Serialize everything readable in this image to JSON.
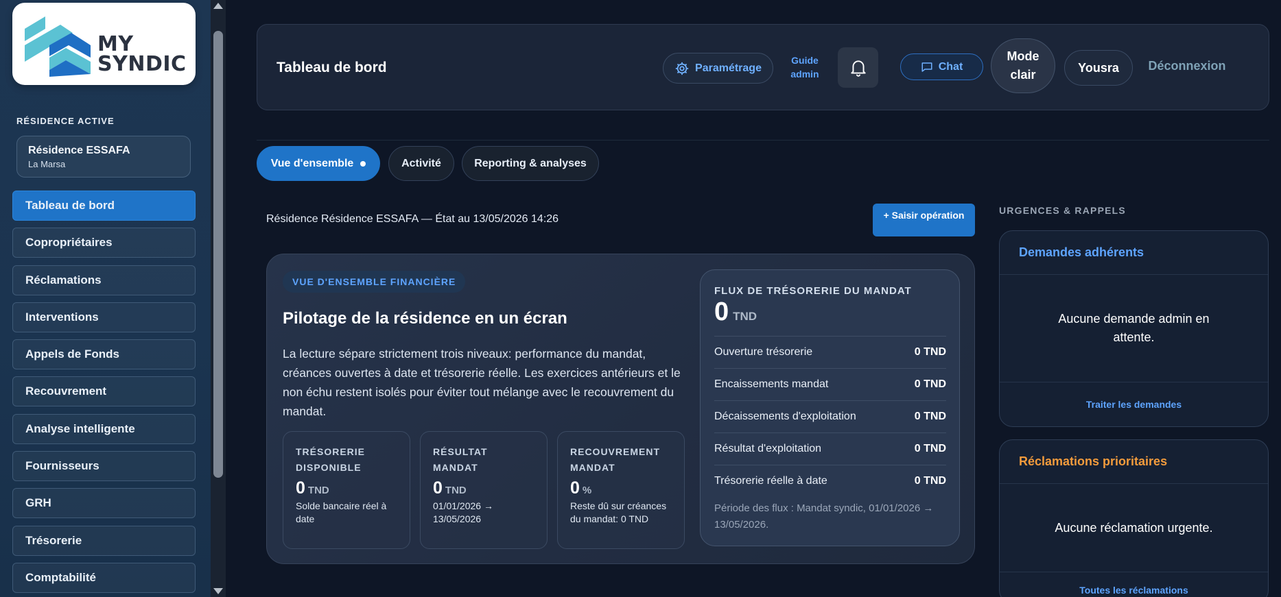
{
  "logo": {
    "line1": "MY",
    "line2": "SYNDIC"
  },
  "sidebar": {
    "active_residence_label": "RÉSIDENCE ACTIVE",
    "residence": {
      "name": "Résidence ESSAFA",
      "city": "La Marsa"
    },
    "items": [
      {
        "label": "Tableau de bord",
        "active": true
      },
      {
        "label": "Copropriétaires"
      },
      {
        "label": "Réclamations"
      },
      {
        "label": "Interventions"
      },
      {
        "label": "Appels de Fonds"
      },
      {
        "label": "Recouvrement"
      },
      {
        "label": "Analyse intelligente"
      },
      {
        "label": "Fournisseurs"
      },
      {
        "label": "GRH"
      },
      {
        "label": "Trésorerie"
      },
      {
        "label": "Comptabilité"
      }
    ]
  },
  "header": {
    "title": "Tableau de bord",
    "parametrage": "Paramétrage",
    "guide_line1": "Guide",
    "guide_line2": "admin",
    "chat": "Chat",
    "mode_line1": "Mode",
    "mode_line2": "clair",
    "user": "Yousra",
    "logout": "Déconnexion"
  },
  "tabs": [
    {
      "label": "Vue d'ensemble",
      "active": true
    },
    {
      "label": "Activité"
    },
    {
      "label": "Reporting & analyses"
    }
  ],
  "main": {
    "status_line": "Résidence Résidence ESSAFA — État au 13/05/2026 14:26",
    "saisir_button": "+ Saisir opération",
    "financial": {
      "badge": "VUE D'ENSEMBLE FINANCIÈRE",
      "title": "Pilotage de la résidence en un écran",
      "description": "La lecture sépare strictement trois niveaux: performance du mandat, créances ouvertes à date et trésorerie réelle. Les exercices antérieurs et le non échu restent isolés pour éviter tout mélange avec le recouvrement du mandat.",
      "kpis": [
        {
          "label_line1": "TRÉSORERIE",
          "label_line2": "DISPONIBLE",
          "value": "0",
          "unit": "TND",
          "sub": "Solde bancaire réel à date"
        },
        {
          "label_line1": "RÉSULTAT",
          "label_line2": "MANDAT",
          "value": "0",
          "unit": "TND",
          "sub": "01/01/2026 → 13/05/2026"
        },
        {
          "label_line1": "RECOUVREMENT",
          "label_line2": "MANDAT",
          "value": "0",
          "unit": "%",
          "sub": "Reste dû sur créances du mandat: 0 TND"
        }
      ]
    },
    "flux": {
      "title": "FLUX DE TRÉSORERIE DU MANDAT",
      "total": "0",
      "unit": "TND",
      "rows": [
        {
          "label": "Ouverture trésorerie",
          "value": "0 TND"
        },
        {
          "label": "Encaissements mandat",
          "value": "0 TND"
        },
        {
          "label": "Décaissements d'exploitation",
          "value": "0 TND"
        },
        {
          "label": "Résultat d'exploitation",
          "value": "0 TND"
        },
        {
          "label": "Trésorerie réelle à date",
          "value": "0 TND"
        }
      ],
      "period": "Période des flux : Mandat syndic, 01/01/2026 → 13/05/2026."
    }
  },
  "right": {
    "section_label": "URGENCES & RAPPELS",
    "demandes": {
      "title": "Demandes adhérents",
      "empty": "Aucune demande admin en attente.",
      "link": "Traiter les demandes"
    },
    "reclamations": {
      "title": "Réclamations prioritaires",
      "empty": "Aucune réclamation urgente.",
      "link": "Toutes les réclamations"
    }
  },
  "colors": {
    "accent": "#1f74c8",
    "link": "#5ea4ff",
    "demandes_title": "#5ea4ff",
    "reclamations_title": "#f29b3c",
    "logo_blue": "#1f6fc4",
    "logo_teal": "#5bc2d3"
  },
  "icons": [
    "gear-icon",
    "bell-icon",
    "chat-icon",
    "scroll-up-arrow-icon",
    "scroll-down-arrow-icon"
  ]
}
